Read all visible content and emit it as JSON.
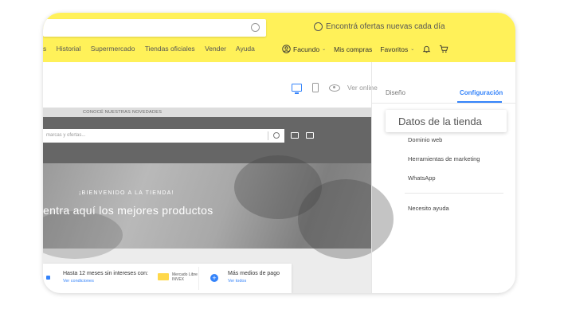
{
  "header": {
    "search_placeholder": "",
    "promo_text": "Encontrá ofertas nuevas cada día",
    "nav_items": [
      "s",
      "Historial",
      "Supermercado",
      "Tiendas oficiales",
      "Vender",
      "Ayuda"
    ],
    "user_name": "Facundo",
    "my_purchases": "Mis compras",
    "favorites": "Favoritos"
  },
  "toolbar": {
    "view_online": "Ver online"
  },
  "preview": {
    "banner_text": "CONOCÉ NUESTRAS NOVEDADES",
    "search_placeholder": "marcas y ofertas...",
    "hero_kicker": "¡BIENVENIDO A LA TIENDA!",
    "hero_title": "entra aquí los mejores productos",
    "payment": {
      "installments_text": "Hasta 12 meses sin intereses con:",
      "installments_link": "Ver condiciones",
      "card_label_1": "Mercado Libre",
      "card_label_2": "INVEX",
      "more_methods_text": "Más medios de pago",
      "more_methods_link": "Ver todos"
    }
  },
  "sidebar": {
    "tabs": [
      {
        "label": "Diseño",
        "active": false
      },
      {
        "label": "Configuración",
        "active": true
      }
    ],
    "highlighted_item": "Datos de la tienda",
    "items": [
      {
        "label": "Dominio web"
      },
      {
        "label": "Herramientas de marketing"
      },
      {
        "label": "WhatsApp"
      },
      {
        "label": "Necesito ayuda"
      }
    ]
  },
  "colors": {
    "header_bg": "#fff159",
    "accent": "#3483fa",
    "preview_header": "#666666"
  }
}
